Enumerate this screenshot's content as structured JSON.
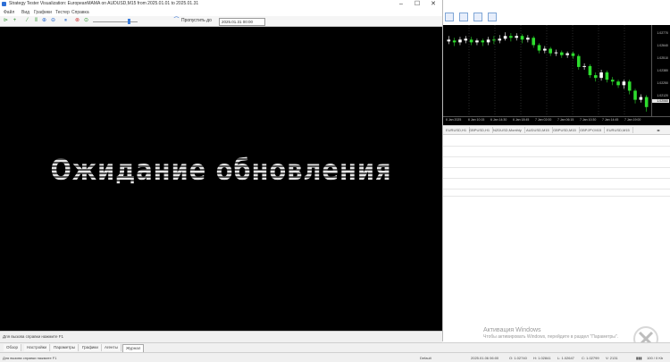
{
  "tester": {
    "title": "Strategy Tester Visualization: EuropeanMAMA on AUDUSD,M15 from 2025.01.01 to 2025.01.31",
    "menu": [
      "Файл",
      "Вид",
      "Графики",
      "Тестер",
      "Справка"
    ],
    "skip_label": "Пропустить до",
    "date_value": "2025.01.31 00:00",
    "canvas_text": "Ожидание обновления",
    "status_text": "Для вызова справки нажмите F1"
  },
  "chart": {
    "price_ticks": [
      "1.02770",
      "1.02640",
      "1.02510",
      "1.02380",
      "1.02250",
      "1.02120",
      "1.02060"
    ],
    "last_price": "1.02060",
    "time_ticks": [
      "6 Jan 2025",
      "6 Jan 10:15",
      "6 Jan 14:30",
      "6 Jan 18:45",
      "7 Jan 02:00",
      "7 Jan 06:15",
      "7 Jan 10:30",
      "7 Jan 14:45",
      "7 Jan 19:00"
    ],
    "candle_colors": {
      "up": "#ffffff",
      "down": "#2ddc2d"
    }
  },
  "symbol_tabs": [
    "EURUSD,H1",
    "GBPUSD,H1",
    "NZDUSD,Monthly",
    "AUDUSD,M15",
    "GBPUSD,M15",
    "GBPJPY,M15",
    "EURUSD,M15"
  ],
  "bottom_tabs": [
    "Обзор",
    "Настройки",
    "Параметры",
    "Графики",
    "Агенты",
    "Журнал"
  ],
  "active_bottom_tab": "Журнал",
  "statusbar": {
    "help": "Для вызова справки нажмите F1",
    "profile": "Default",
    "datetime": "2025.01.06 06:00",
    "open": "O: 1.02740",
    "high": "H: 1.02841",
    "low": "L: 1.02647",
    "close": "C: 1.02799",
    "volume": "V: 2131",
    "traffic": "100 / 0 Kb"
  },
  "activation": {
    "title": "Активация Windows",
    "subtitle": "Чтобы активировать Windows, перейдите в раздел \"Параметры\"."
  }
}
